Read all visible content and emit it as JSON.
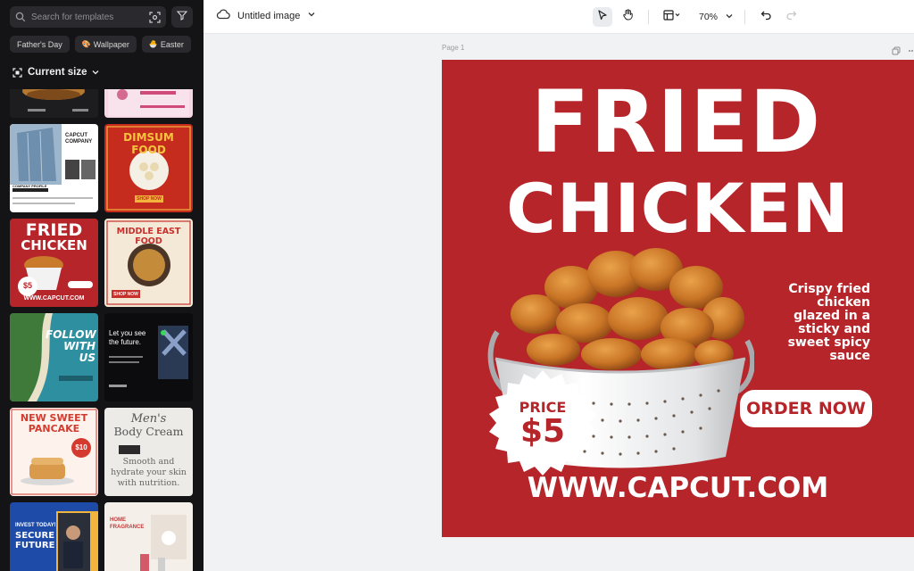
{
  "sidebar": {
    "search_placeholder": "Search for templates",
    "chips": [
      {
        "label": "Father's Day",
        "emoji": ""
      },
      {
        "label": "Wallpaper",
        "emoji": "🎨"
      },
      {
        "label": "Easter",
        "emoji": "🐣"
      }
    ],
    "section_title": "Current size",
    "templates": {
      "t1_title": "CAPCUT COMPANY",
      "t1_sub": "COMPANY PROFILE",
      "t2_title": "DIMSUM FOOD",
      "t2_cta": "SHOP NOW",
      "t3_title1": "FRIED",
      "t3_title2": "CHICKEN",
      "t3_price": "$5",
      "t3_url": "WWW.CAPCUT.COM",
      "t4_title": "MIDDLE EAST FOOD",
      "t4_cta": "SHOP NOW",
      "t5_title1": "FOLLOW",
      "t5_title2": "WITH",
      "t5_title3": "US",
      "t6_title1": "Let you see",
      "t6_title2": "the future.",
      "t7_title1": "NEW SWEET",
      "t7_title2": "PANCAKE",
      "t7_price": "$10",
      "t8_title1": "Men's",
      "t8_title2": "Body Cream",
      "t8_sub1": "Smooth and",
      "t8_sub2": "hydrate your skin",
      "t8_sub3": "with nutrition.",
      "t9_title1": "INVEST TODAY!",
      "t9_title2": "SECURE",
      "t9_title3": "FUTURE",
      "t10_title1": "HOME",
      "t10_title2": "FRAGRANCE"
    }
  },
  "topbar": {
    "doc_title": "Untitled image",
    "zoom": "70%"
  },
  "canvas": {
    "page_label": "Page 1",
    "poster": {
      "title1": "FRIED",
      "title2": "CHICKEN",
      "description_lines": [
        "Crispy fried",
        "chicken",
        "glazed in a",
        "sticky and",
        "sweet spicy",
        "sauce"
      ],
      "order_button": "ORDER NOW",
      "price_label": "PRICE",
      "price_value": "$5",
      "url": "WWW.CAPCUT.COM"
    }
  },
  "colors": {
    "poster_red": "#b6252a",
    "sidebar_bg": "#141416"
  }
}
